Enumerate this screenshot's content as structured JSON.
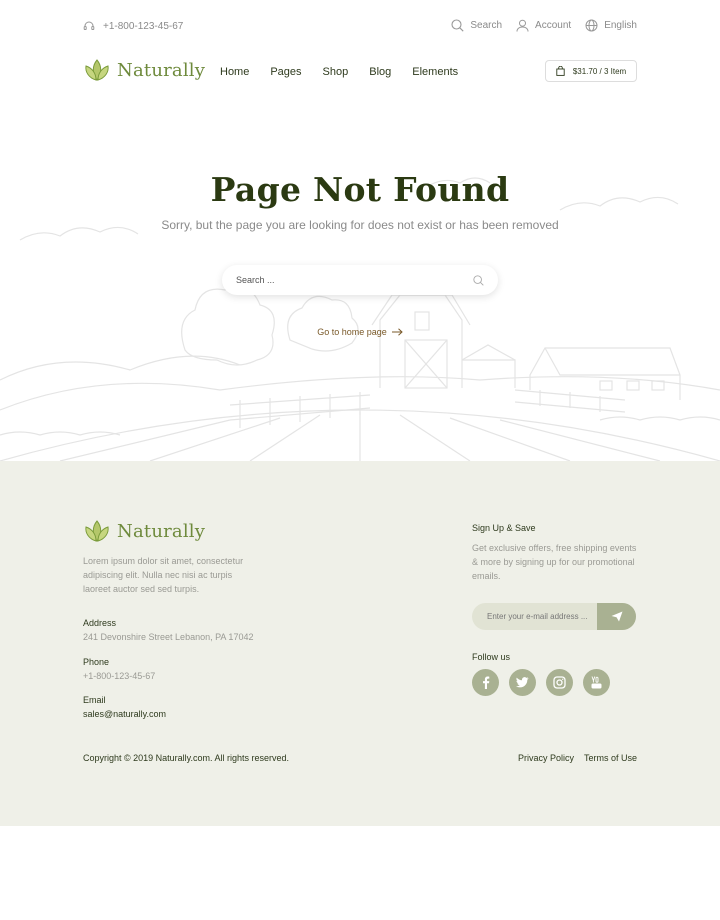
{
  "topbar": {
    "phone": "+1-800-123-45-67",
    "search_label": "Search",
    "account_label": "Account",
    "language_label": "English"
  },
  "nav": {
    "logo": "Naturally",
    "items": [
      "Home",
      "Pages",
      "Shop",
      "Blog",
      "Elements"
    ],
    "cart": "$31.70 / 3 Item"
  },
  "hero": {
    "title": "Page Not Found",
    "subtitle": "Sorry, but the page you are looking for does not exist or has been removed",
    "search_placeholder": "Search ...",
    "home_link": "Go to home page"
  },
  "footer": {
    "logo": "Naturally",
    "description": "Lorem ipsum dolor sit amet, consectetur adipiscing elit. Nulla nec nisi ac turpis laoreet auctor sed sed turpis.",
    "address_heading": "Address",
    "address": "241 Devonshire Street Lebanon, PA 17042",
    "phone_heading": "Phone",
    "phone": "+1-800-123-45-67",
    "email_heading": "Email",
    "email": "sales@naturally.com",
    "signup_heading": "Sign Up & Save",
    "signup_desc": "Get exclusive offers, free shipping events & more by signing up for our promotional emails.",
    "email_placeholder": "Enter your e-mail address ...",
    "follow_heading": "Follow us",
    "socials": [
      "facebook-icon",
      "twitter-icon",
      "instagram-icon",
      "youtube-icon"
    ],
    "copyright": "Copyright © 2019 Naturally.com. All rights reserved.",
    "privacy": "Privacy Policy",
    "terms": "Terms of Use"
  },
  "colors": {
    "brand_green": "#6e8a3c",
    "dark_green": "#2b3a12",
    "footer_bg": "#eff0e8",
    "social_bg": "#a9b192"
  }
}
